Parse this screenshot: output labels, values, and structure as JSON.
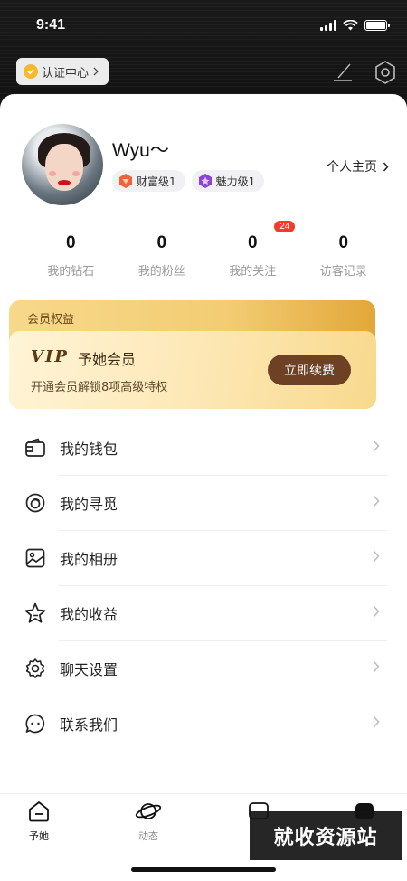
{
  "status_bar": {
    "time": "9:41"
  },
  "header": {
    "cert_label": "认证中心",
    "edit_icon": "pen-icon",
    "settings_icon": "settings-hexagon-icon"
  },
  "profile": {
    "username": "Wyu～",
    "badges": [
      {
        "label": "财富级1",
        "icon": "wealth-level-icon",
        "color": "#f0623a"
      },
      {
        "label": "魅力级1",
        "icon": "charm-level-icon",
        "color": "#8a44d8"
      }
    ],
    "homepage_label": "个人主页"
  },
  "stats": [
    {
      "value": "0",
      "label": "我的钻石"
    },
    {
      "value": "0",
      "label": "我的粉丝"
    },
    {
      "value": "0",
      "label": "我的关注",
      "badge": "24"
    },
    {
      "value": "0",
      "label": "访客记录"
    }
  ],
  "vip": {
    "section_title": "会员权益",
    "logo": "VIP",
    "name": "予她会员",
    "description": "开通会员解锁8项高级特权",
    "button": "立即续费"
  },
  "menu": [
    {
      "label": "我的钱包",
      "icon": "wallet-icon"
    },
    {
      "label": "我的寻觅",
      "icon": "explore-icon"
    },
    {
      "label": "我的相册",
      "icon": "album-icon"
    },
    {
      "label": "我的收益",
      "icon": "star-icon"
    },
    {
      "label": "聊天设置",
      "icon": "gear-icon"
    },
    {
      "label": "联系我们",
      "icon": "chat-bubble-icon"
    }
  ],
  "tabbar": [
    {
      "label": "予她",
      "icon": "home-icon"
    },
    {
      "label": "动态",
      "icon": "planet-icon"
    }
  ],
  "watermark": "就收资源站",
  "colors": {
    "accent_brown": "#6e4124",
    "badge_red": "#f23a2f",
    "vip_gold": "#f3cc73"
  }
}
